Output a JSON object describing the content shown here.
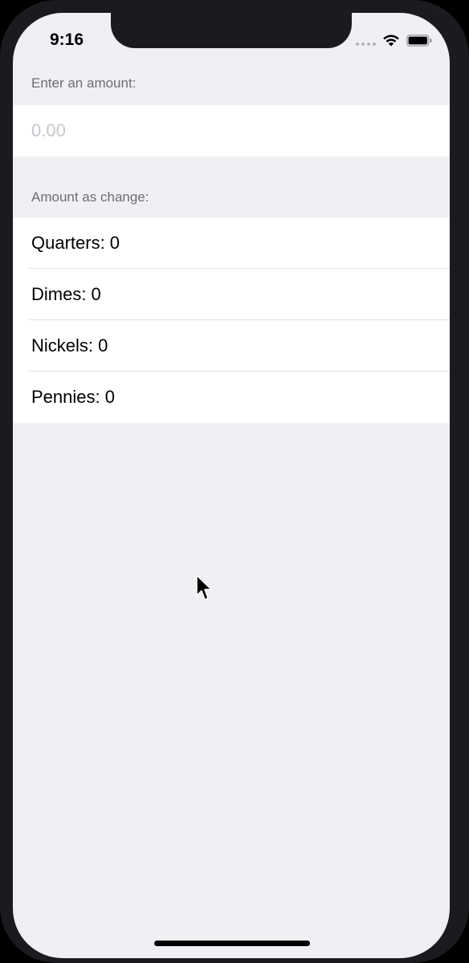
{
  "status_bar": {
    "time": "9:16",
    "icons": [
      "cellular-signal-icon",
      "wifi-icon",
      "battery-icon"
    ]
  },
  "form": {
    "amount_section": {
      "header": "Enter an amount:",
      "input_value": "",
      "input_placeholder": "0.00"
    },
    "change_section": {
      "header": "Amount as change:",
      "rows": [
        {
          "label": "Quarters: 0"
        },
        {
          "label": "Dimes: 0"
        },
        {
          "label": "Nickels: 0"
        },
        {
          "label": "Pennies: 0"
        }
      ]
    }
  },
  "colors": {
    "background": "#efeff4",
    "header_text": "#6d6d72",
    "placeholder": "#c7c7cd",
    "cell_background": "#ffffff"
  }
}
